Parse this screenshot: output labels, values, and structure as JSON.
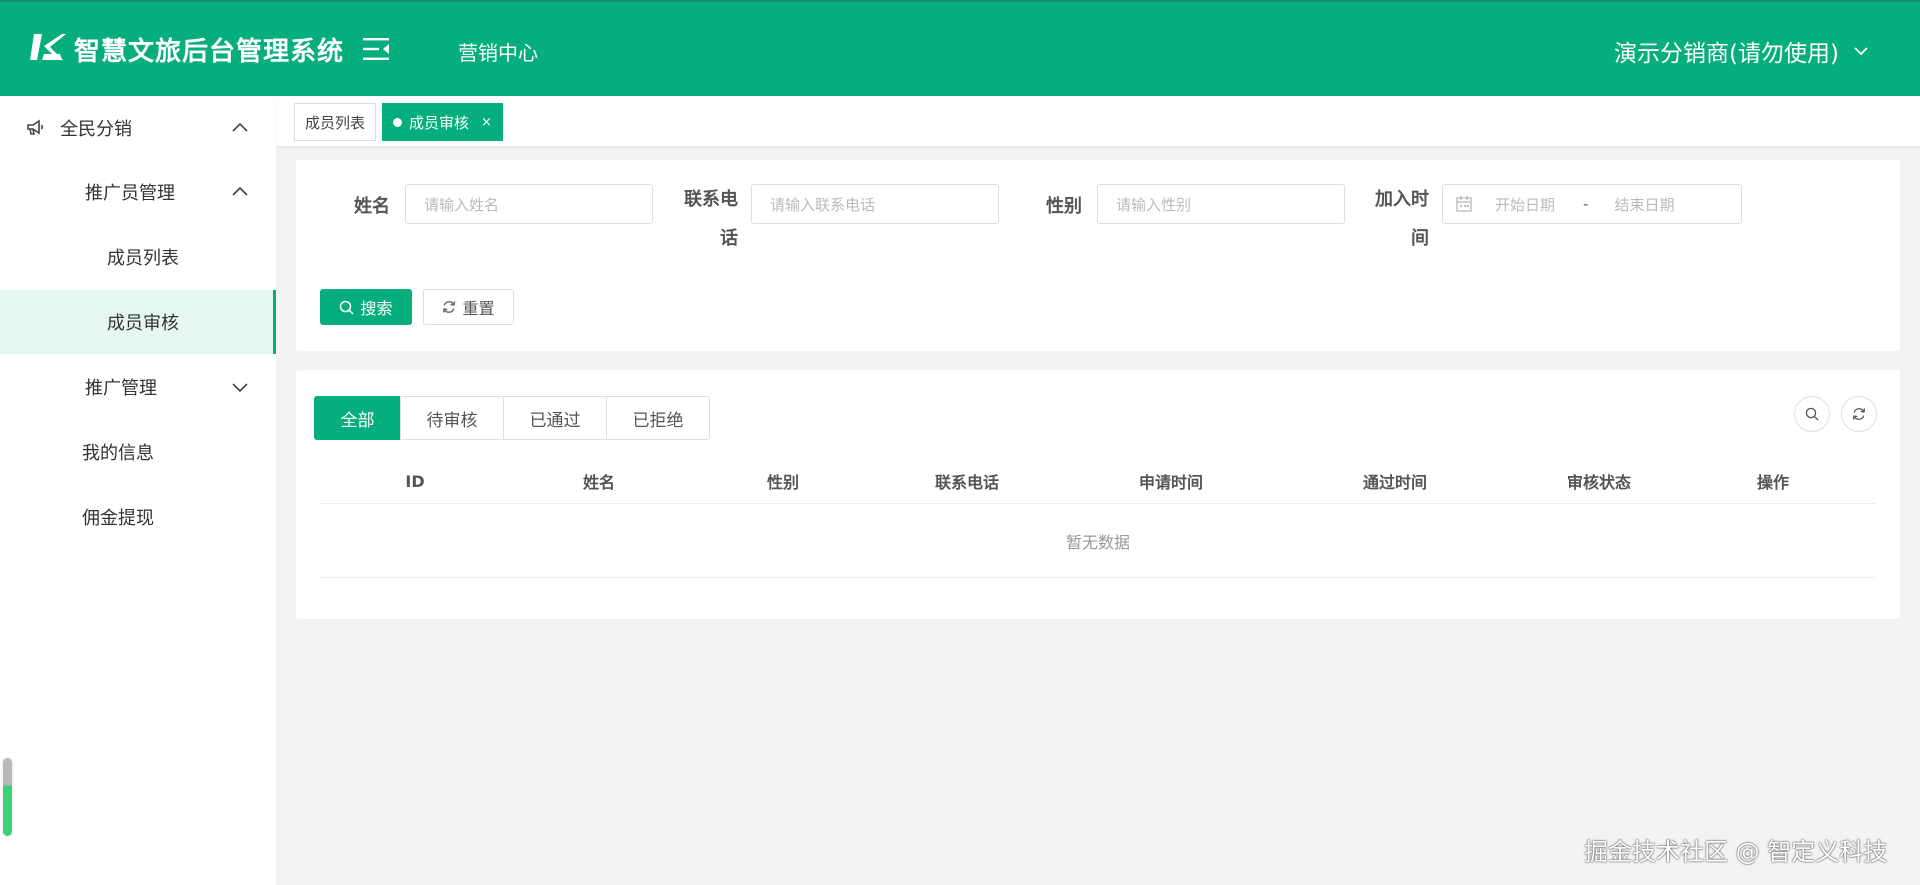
{
  "header": {
    "app_title": "智慧文旅后台管理系统",
    "nav_label": "营销中心",
    "user_label": "演示分销商(请勿使用)"
  },
  "sidebar": {
    "group": {
      "label": "全民分销",
      "icon": "megaphone-icon",
      "expanded": true
    },
    "items": [
      {
        "label": "推广员管理",
        "expanded": true
      },
      {
        "label": "成员列表"
      },
      {
        "label": "成员审核",
        "active": true
      },
      {
        "label": "推广管理",
        "expanded": false
      },
      {
        "label": "我的信息"
      },
      {
        "label": "佣金提现"
      }
    ]
  },
  "tabs": [
    {
      "label": "成员列表",
      "active": false
    },
    {
      "label": "成员审核",
      "active": true,
      "close": "×"
    }
  ],
  "search_form": {
    "name_label": "姓名",
    "name_placeholder": "请输入姓名",
    "phone_label": "联系电话",
    "phone_placeholder": "请输入联系电话",
    "gender_label": "性别",
    "gender_placeholder": "请输入性别",
    "join_time_label": "加入时间",
    "start_date_placeholder": "开始日期",
    "range_separator": "-",
    "end_date_placeholder": "结束日期",
    "search_button": "搜索",
    "reset_button": "重置"
  },
  "status_tabs": [
    {
      "label": "全部",
      "active": true
    },
    {
      "label": "待审核"
    },
    {
      "label": "已通过"
    },
    {
      "label": "已拒绝"
    }
  ],
  "table": {
    "columns": [
      "ID",
      "姓名",
      "性别",
      "联系电话",
      "申请时间",
      "通过时间",
      "审核状态",
      "操作"
    ],
    "empty_text": "暂无数据"
  },
  "watermark": "掘金技术社区 @ 智定义科技",
  "colors": {
    "primary": "#05ae7c",
    "active_bg": "#e6f6f0"
  }
}
